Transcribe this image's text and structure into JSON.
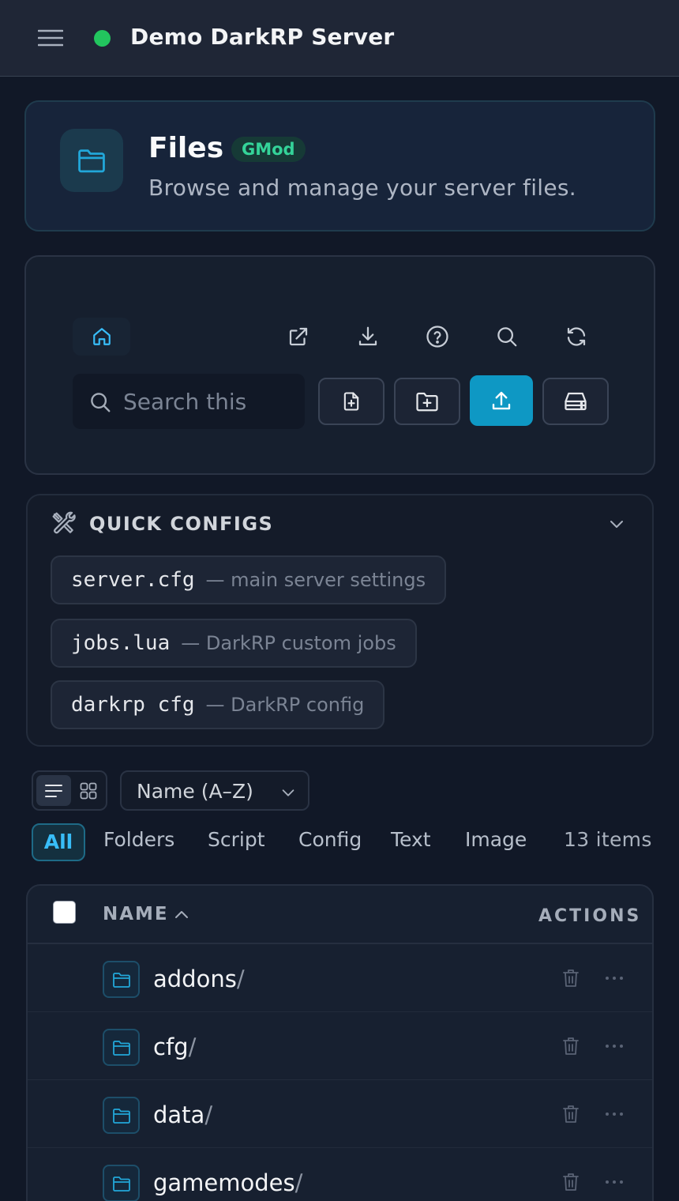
{
  "topbar": {
    "server_name": "Demo DarkRP Server",
    "status": "online",
    "status_color": "#22c55e"
  },
  "header": {
    "title": "Files",
    "badge": "GMod",
    "subtitle": "Browse and manage your server files.",
    "icon": "folder-icon"
  },
  "toolbar": {
    "icons": [
      "home-icon",
      "external-link-icon",
      "download-icon",
      "help-icon",
      "search-icon",
      "refresh-icon"
    ],
    "search_placeholder": "Search this",
    "buttons": [
      "new-file-icon",
      "new-folder-icon",
      "upload-icon",
      "storage-icon"
    ],
    "accent_color": "#0e98c4"
  },
  "quick_configs": {
    "title": "QUICK CONFIGS",
    "items": [
      {
        "file": "server.cfg",
        "desc": "— main server settings"
      },
      {
        "file": "jobs.lua",
        "desc": "— DarkRP custom jobs"
      },
      {
        "file": "darkrp cfg",
        "desc": "— DarkRP config"
      }
    ]
  },
  "view": {
    "mode": "list",
    "sort": "Name (A–Z)"
  },
  "filters": {
    "items": [
      "All",
      "Folders",
      "Script",
      "Config",
      "Text",
      "Image"
    ],
    "active": "All",
    "count": "13 items"
  },
  "table": {
    "col_name": "NAME",
    "col_actions": "ACTIONS",
    "rows": [
      {
        "name": "addons",
        "suffix": "/"
      },
      {
        "name": "cfg",
        "suffix": "/"
      },
      {
        "name": "data",
        "suffix": "/"
      },
      {
        "name": "gamemodes",
        "suffix": "/"
      }
    ]
  }
}
